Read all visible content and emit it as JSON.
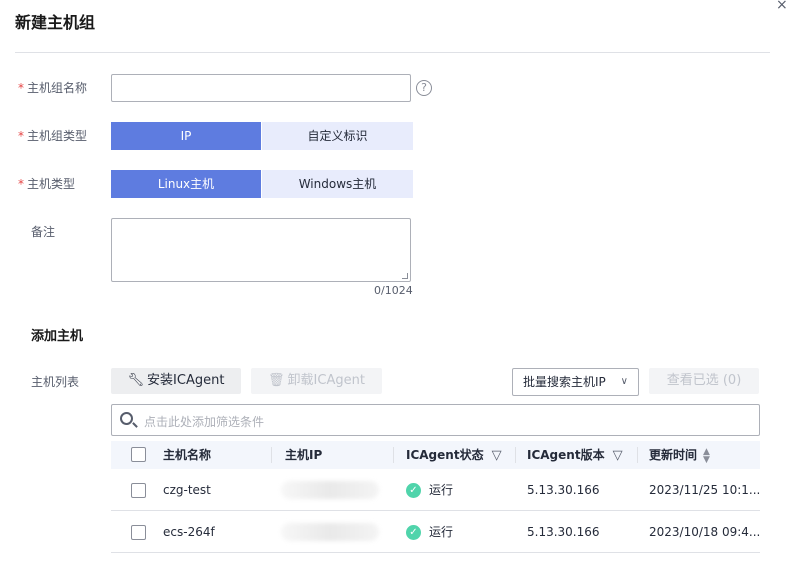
{
  "dialog": {
    "title": "新建主机组",
    "close_glyph": "×"
  },
  "form": {
    "name_label": "主机组名称",
    "type_label": "主机组类型",
    "type_options": [
      "IP",
      "自定义标识"
    ],
    "type_selected": "IP",
    "host_type_label": "主机类型",
    "host_type_options": [
      "Linux主机",
      "Windows主机"
    ],
    "host_type_selected": "Linux主机",
    "remark_label": "备注",
    "remark_counter": "0/1024",
    "required_mark": "*",
    "help_glyph": "?"
  },
  "add_host": {
    "section_title": "添加主机",
    "list_label": "主机列表",
    "install_button": "安装ICAgent",
    "uninstall_button": "卸载ICAgent",
    "batch_search": "批量搜索主机IP",
    "view_selected": "查看已选 (0)",
    "filter_placeholder": "点击此处添加筛选条件"
  },
  "table": {
    "columns": [
      "主机名称",
      "主机IP",
      "ICAgent状态",
      "ICAgent版本",
      "更新时间"
    ],
    "rows": [
      {
        "name": "czg-test",
        "ip": "",
        "status": "运行",
        "version": "5.13.30.166",
        "updated": "2023/11/25 10:1..."
      },
      {
        "name": "ecs-264f",
        "ip": "",
        "status": "运行",
        "version": "5.13.30.166",
        "updated": "2023/10/18 09:4..."
      }
    ]
  },
  "colors": {
    "accent": "#5e7ce0",
    "accent_light": "#e8ecfc",
    "required": "#e54545",
    "status_ok": "#50d4ab"
  },
  "icons": [
    "close-icon",
    "help-icon",
    "wrench-icon",
    "trash-icon",
    "chevron-down-icon",
    "search-icon",
    "filter-icon",
    "sort-icon",
    "check-circle-icon"
  ]
}
